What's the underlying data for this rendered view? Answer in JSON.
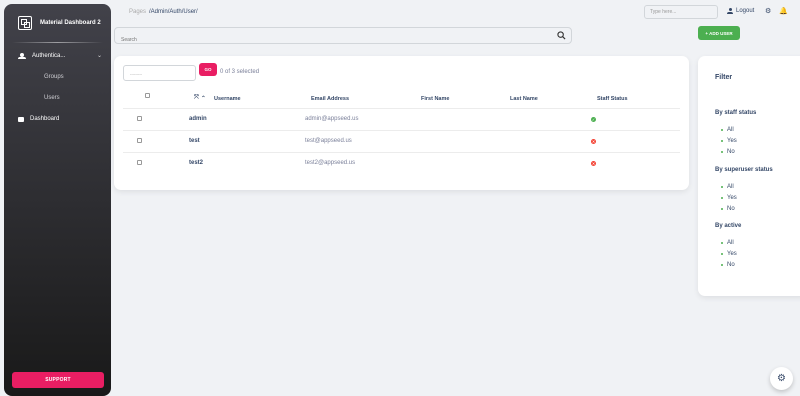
{
  "sidebar": {
    "brand": "Material Dashboard 2",
    "group_label": "Authentica...",
    "sub_items": [
      {
        "label": "Groups"
      },
      {
        "label": "Users"
      }
    ],
    "dashboard_label": "Dashboard",
    "support_label": "SUPPORT"
  },
  "breadcrumb": {
    "pages": "Pages",
    "path": "/Admin/Auth/User/"
  },
  "topbar": {
    "search_placeholder": "Type here...",
    "logout_label": "Logout"
  },
  "search": {
    "placeholder": "Search"
  },
  "add_user_label": "+ ADD USER",
  "actions": {
    "select_text": "---------",
    "go_label": "GO",
    "selected_text": "0 of 3 selected"
  },
  "table": {
    "columns": [
      "Username",
      "Email Address",
      "First Name",
      "Last Name",
      "Staff Status"
    ],
    "rows": [
      {
        "username": "admin",
        "email": "admin@appseed.us",
        "first_name": "",
        "last_name": "",
        "staff": true
      },
      {
        "username": "test",
        "email": "test@appseed.us",
        "first_name": "",
        "last_name": "",
        "staff": false
      },
      {
        "username": "test2",
        "email": "test2@appseed.us",
        "first_name": "",
        "last_name": "",
        "staff": false
      }
    ]
  },
  "filter": {
    "title": "Filter",
    "groups": [
      {
        "title": "By staff status",
        "options": [
          "All",
          "Yes",
          "No"
        ]
      },
      {
        "title": "By superuser status",
        "options": [
          "All",
          "Yes",
          "No"
        ]
      },
      {
        "title": "By active",
        "options": [
          "All",
          "Yes",
          "No"
        ]
      }
    ]
  },
  "colors": {
    "primary": "#e91e63",
    "success": "#4caf50",
    "danger": "#f44335",
    "text": "#344767"
  }
}
